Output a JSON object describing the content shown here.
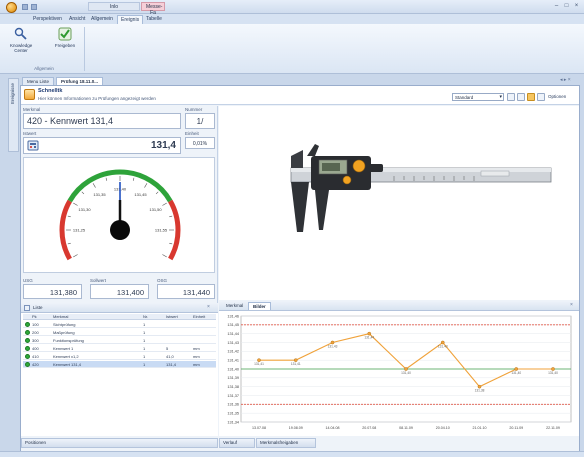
{
  "titlebar": {
    "context_group_1": "Inlo",
    "context_group_2": "Messe-Fa"
  },
  "ribbon": {
    "tabs": [
      "Perspektiven",
      "Ansicht",
      "Allgemein",
      "Ereignis",
      "Tabelle"
    ],
    "active_tab": "Ereignis",
    "buttons": [
      {
        "label": "Knowledge Center",
        "icon": "knowledge-center-icon"
      },
      {
        "label": "Freigeben",
        "icon": "check-icon"
      }
    ],
    "group_label": "Allgemein"
  },
  "sidestrip_label": "Ereignisse",
  "doc_tabs": [
    "Menu Liste",
    "Prüfung 18.11.0..."
  ],
  "step": {
    "title": "Schnelltk",
    "subtitle": "Hier können Informationen zu Prüfungen angezeigt werden"
  },
  "toolbar": {
    "select_value": "Standard",
    "options_label": "Optionen"
  },
  "measure": {
    "name_caption": "Merkmal",
    "name_value": "420 - Kennwert 131,4",
    "number_caption": "Nummer",
    "number_value": "1/",
    "value_caption": "Istwert",
    "value": "131,4",
    "unit_caption": "Einheit",
    "unit_value": "0,01%"
  },
  "gauge": {
    "min": 131.2,
    "max": 131.6,
    "current": 131.4,
    "tick_labels": [
      "131,25",
      "131,30",
      "131,35",
      "131,40",
      "131,45",
      "131,50",
      "131,55"
    ],
    "zone_colors": {
      "low": "#d8382f",
      "ok": "#2ea33a",
      "high": "#d8382f"
    }
  },
  "limits": [
    {
      "caption": "USG",
      "value": "131,380"
    },
    {
      "caption": "Sollwert",
      "value": "131,400"
    },
    {
      "caption": "OSG",
      "value": "131,440"
    }
  ],
  "list": {
    "title": "Liste",
    "headers": [
      "Pk",
      "Merkmal",
      "Nr.",
      "Istwert",
      "Einheit"
    ],
    "rows": [
      {
        "pk": "100",
        "merkmal": "Sichtprüfung",
        "nr": "1",
        "ist": "",
        "einheit": ""
      },
      {
        "pk": "200",
        "merkmal": "Maßprüfung",
        "nr": "1",
        "ist": "",
        "einheit": ""
      },
      {
        "pk": "300",
        "merkmal": "Funktionsprüfung",
        "nr": "1",
        "ist": "",
        "einheit": ""
      },
      {
        "pk": "400",
        "merkmal": "Kennwert 1",
        "nr": "1",
        "ist": "5",
        "einheit": "mm"
      },
      {
        "pk": "410",
        "merkmal": "Kennwert x1,2",
        "nr": "1",
        "ist": "41,0",
        "einheit": "mm"
      },
      {
        "pk": "420",
        "merkmal": "Kennwert 131,4",
        "nr": "1",
        "ist": "131,4",
        "einheit": "mm"
      }
    ]
  },
  "chart_tabs": [
    "Merkmal",
    "Bilder"
  ],
  "chart_data": {
    "type": "line",
    "x": [
      "13.07.08",
      "19.08.09",
      "14.04.08",
      "20.07.08",
      "08.11.09",
      "20.04.10",
      "21.01.10",
      "20.11.09",
      "22.11.09"
    ],
    "y": [
      131.41,
      131.41,
      131.43,
      131.44,
      131.4,
      131.43,
      131.38,
      131.4,
      131.4
    ],
    "ylim": [
      131.34,
      131.46
    ],
    "ytick_labels": [
      "131,46",
      "131,45",
      "131,44",
      "131,43",
      "131,42",
      "131,41",
      "131,40",
      "131,39",
      "131,38",
      "131,37",
      "131,36",
      "131,35",
      "131,34"
    ],
    "lsl": 131.36,
    "usl": 131.45,
    "target": 131.4,
    "grid": true,
    "colors": {
      "series": "#f0a23a",
      "limits": "#e05a4a",
      "target": "#3fa04a"
    }
  },
  "bottom": {
    "left_strip": "Positionen",
    "right_strip_1": "Verlauf",
    "right_strip_2": "Merkmalsfreigaben"
  }
}
